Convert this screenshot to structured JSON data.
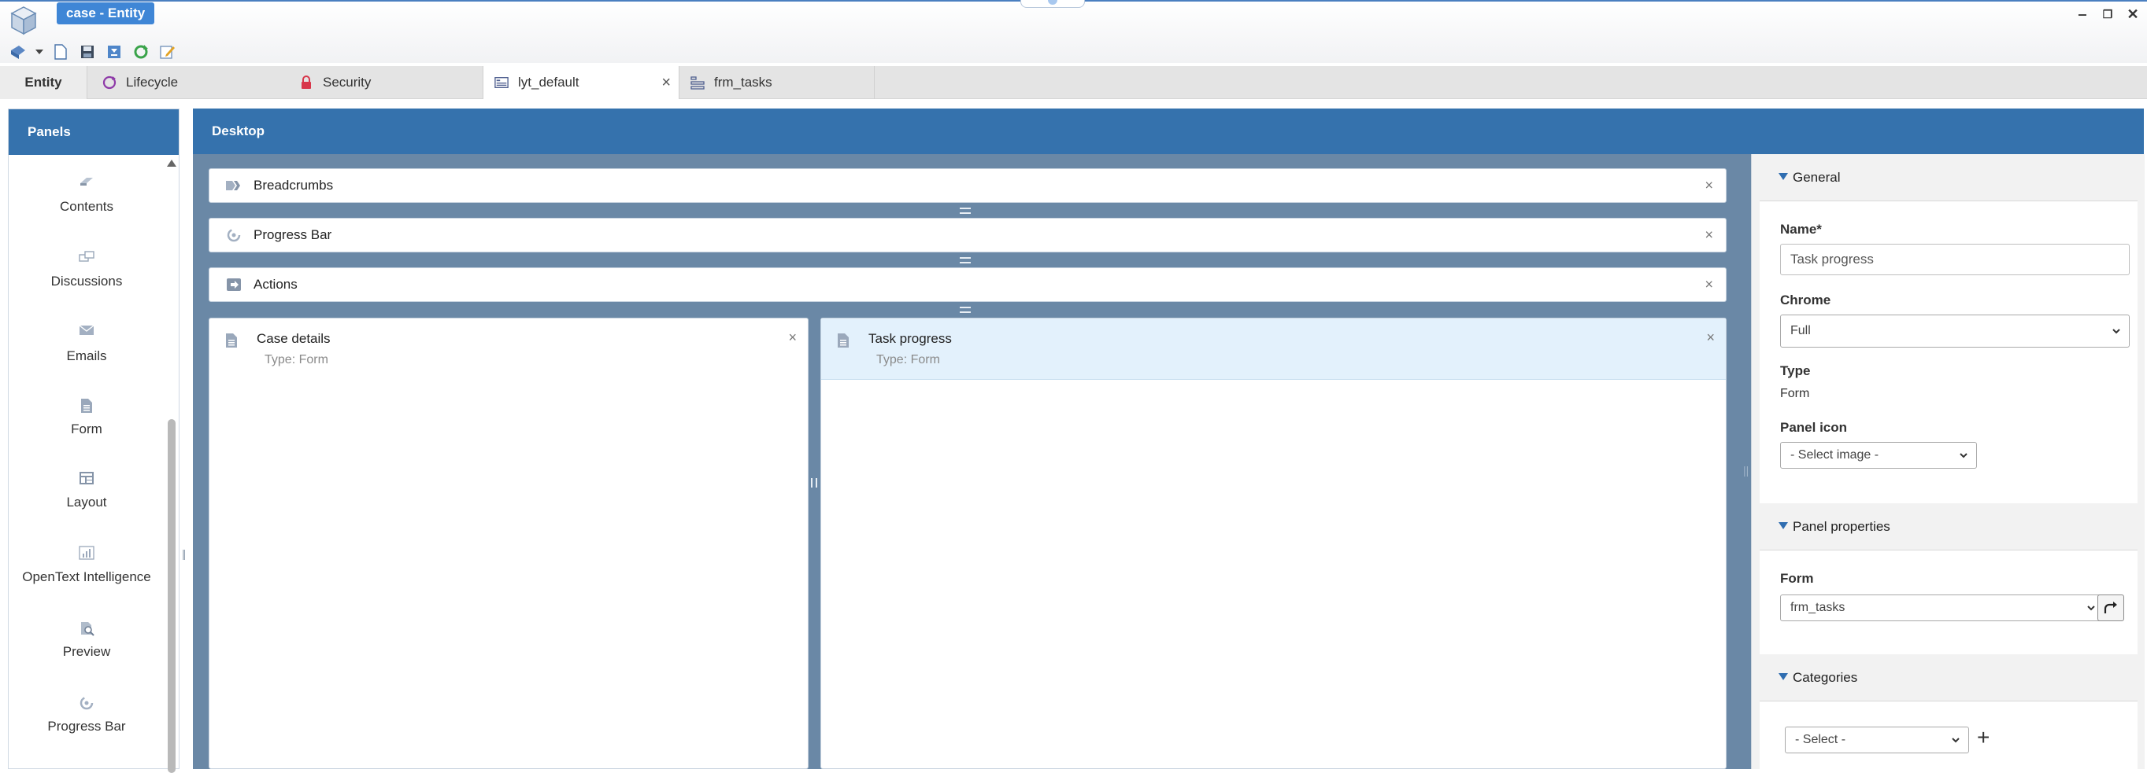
{
  "window": {
    "title": "case - Entity",
    "controls": [
      "minimize",
      "restore",
      "close"
    ]
  },
  "toolbar": {
    "buttons": [
      "publish-icon",
      "dropdown-icon",
      "new-document-icon",
      "save-icon",
      "save-all-icon",
      "refresh-icon",
      "edit-icon"
    ]
  },
  "tabs": [
    {
      "label": "Entity",
      "icon": "none",
      "active": false
    },
    {
      "label": "Lifecycle",
      "icon": "lifecycle-icon",
      "active": false
    },
    {
      "label": "Security",
      "icon": "lock-icon",
      "active": false
    },
    {
      "label": "lyt_default",
      "icon": "layout-icon",
      "active": true,
      "close": "×"
    },
    {
      "label": "frm_tasks",
      "icon": "form-list-icon",
      "active": false
    }
  ],
  "panels": {
    "header": "Panels",
    "items": [
      {
        "label": "Contents",
        "icon": "eraser-icon"
      },
      {
        "label": "Discussions",
        "icon": "discussion-icon"
      },
      {
        "label": "Emails",
        "icon": "envelope-icon"
      },
      {
        "label": "Form",
        "icon": "form-icon"
      },
      {
        "label": "Layout",
        "icon": "layout-grid-icon"
      },
      {
        "label": "OpenText Intelligence",
        "icon": "bar-chart-icon"
      },
      {
        "label": "Preview",
        "icon": "preview-icon"
      },
      {
        "label": "Progress Bar",
        "icon": "progress-icon"
      }
    ]
  },
  "desktop": {
    "header": "Desktop",
    "bars": [
      {
        "label": "Breadcrumbs",
        "icon": "breadcrumb-icon",
        "close": "×"
      },
      {
        "label": "Progress Bar",
        "icon": "progress-icon",
        "close": "×"
      },
      {
        "label": "Actions",
        "icon": "actions-icon",
        "close": "×"
      }
    ],
    "forms": [
      {
        "title": "Case details",
        "type": "Type: Form",
        "close": "×",
        "selected": false
      },
      {
        "title": "Task progress",
        "type": "Type: Form",
        "close": "×",
        "selected": true
      }
    ]
  },
  "properties": {
    "general": {
      "heading": "General",
      "name_label": "Name*",
      "name_value": "Task progress",
      "chrome_label": "Chrome",
      "chrome_value": "Full",
      "type_label": "Type",
      "type_value": "Form",
      "panel_icon_label": "Panel icon",
      "panel_icon_value": "- Select image -"
    },
    "panel_properties": {
      "heading": "Panel properties",
      "form_label": "Form",
      "form_value": "frm_tasks"
    },
    "categories": {
      "heading": "Categories",
      "select_value": "- Select -",
      "add": "+"
    }
  },
  "colors": {
    "header_blue": "#3572ad",
    "desktop_bg": "#6a88a6",
    "selected_panel": "#e3f1fc",
    "title_badge": "#3f86d6"
  }
}
